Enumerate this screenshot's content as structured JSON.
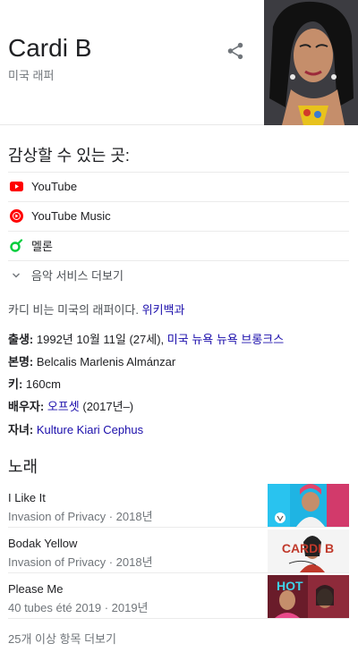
{
  "header": {
    "title": "Cardi B",
    "subtitle": "미국 래퍼"
  },
  "listen": {
    "title": "감상할 수 있는 곳:",
    "services": [
      {
        "label": "YouTube",
        "icon": "youtube-icon",
        "color": "#ff0000"
      },
      {
        "label": "YouTube Music",
        "icon": "youtube-music-icon",
        "color": "#ff0000"
      },
      {
        "label": "멜론",
        "icon": "melon-icon",
        "color": "#00cd3c"
      }
    ],
    "more_label": "음악 서비스 더보기"
  },
  "description": {
    "text": "카디 비는 미국의 래퍼이다. ",
    "source": "위키백과"
  },
  "facts": {
    "born_label": "출생:",
    "born_value": "1992년 10월 11일 (27세),",
    "born_place": "미국 뉴욕 뉴욕 브롱크스",
    "realname_label": "본명:",
    "realname_value": "Belcalis Marlenis Almánzar",
    "height_label": "키:",
    "height_value": "160cm",
    "spouse_label": "배우자:",
    "spouse_link": "오프셋",
    "spouse_years": "(2017년–)",
    "child_label": "자녀:",
    "child_link": "Kulture Kiari Cephus"
  },
  "songs": {
    "title": "노래",
    "items": [
      {
        "name": "I Like It",
        "meta": "Invasion of Privacy · 2018년"
      },
      {
        "name": "Bodak Yellow",
        "meta": "Invasion of Privacy · 2018년",
        "thumb_text": "CARDI B"
      },
      {
        "name": "Please Me",
        "meta": "40 tubes été 2019 · 2019년",
        "thumb_text": "HOT"
      }
    ],
    "more_label": "25개 이상 항목 더보기"
  },
  "colors": {
    "link": "#1a0dab",
    "youtube_red": "#ff0000",
    "melon_green": "#00cd3c"
  }
}
